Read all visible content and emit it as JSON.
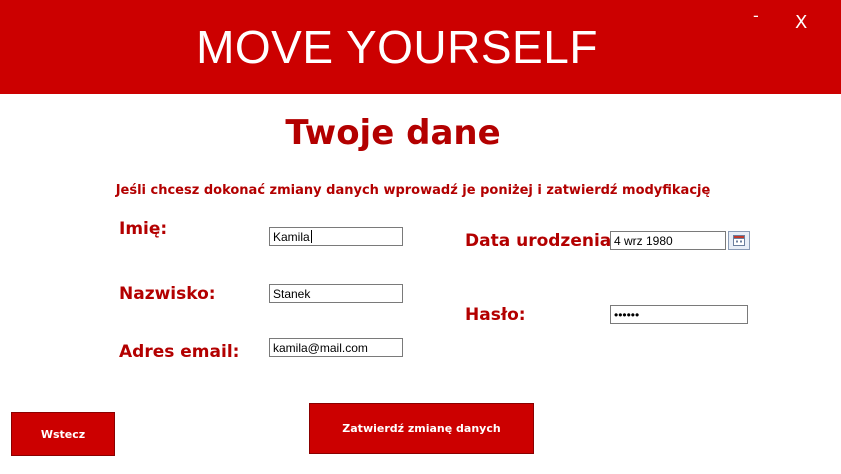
{
  "window": {
    "banner_title": "MOVE YOURSELF",
    "minimize_label": "-",
    "close_label": "X",
    "accent_color": "#cc0000",
    "text_color": "#b30000"
  },
  "page": {
    "title": "Twoje dane",
    "instruction": "Jeśli chcesz dokonać zmiany danych wprowadź je poniżej i zatwierdź modyfikację"
  },
  "form": {
    "first_name_label": "Imię:",
    "first_name_value": "Kamila",
    "last_name_label": "Nazwisko:",
    "last_name_value": "Stanek",
    "email_label": "Adres email:",
    "email_value": "kamila@mail.com",
    "birthdate_label": "Data urodzenia:",
    "birthdate_value": "4 wrz 1980",
    "password_label": "Hasło:",
    "password_value": "••••••",
    "calendar_icon": "calendar-icon"
  },
  "actions": {
    "back_label": "Wstecz",
    "submit_label": "Zatwierdź zmianę danych"
  }
}
